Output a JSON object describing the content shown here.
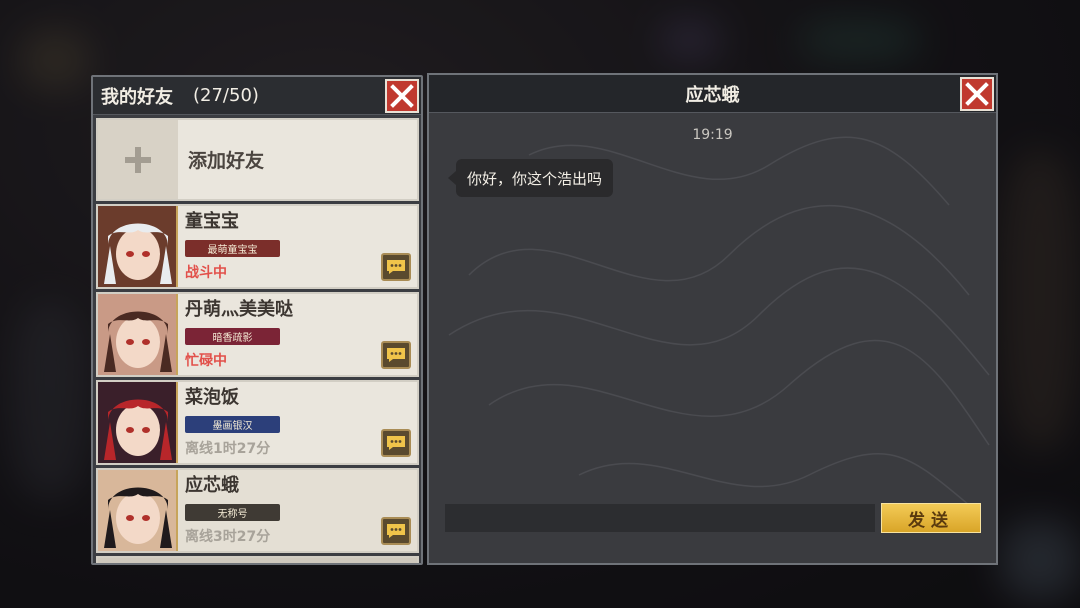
{
  "friends": {
    "title": "我的好友",
    "count": "(27/50)",
    "add_label": "添加好友",
    "list": [
      {
        "name": "童宝宝",
        "title": "最萌童宝宝",
        "status": "战斗中",
        "status_color": "#e2504a",
        "badge_color": "#7b2e2a",
        "avatar_hair": "#e9ecef",
        "avatar_bg": "#6b3c2c"
      },
      {
        "name": "丹萌灬美美哒",
        "title": "暗香疏影",
        "status": "忙碌中",
        "status_color": "#e2504a",
        "badge_color": "#7b2436",
        "avatar_hair": "#4a2a22",
        "avatar_bg": "#c99a86"
      },
      {
        "name": "菜泡饭",
        "title": "墨画银汉",
        "status": "离线1时27分",
        "status_color": "#a8a39a",
        "badge_color": "#2c3f7a",
        "avatar_hair": "#b8262a",
        "avatar_bg": "#3a1f2a"
      },
      {
        "name": "应芯蛾",
        "title": "无称号",
        "status": "离线3时27分",
        "status_color": "#a8a39a",
        "badge_color": "#3f3a34",
        "avatar_hair": "#1f1a1c",
        "avatar_bg": "#d8b79a"
      }
    ]
  },
  "chat": {
    "partner_name": "应芯蛾",
    "time": "19:19",
    "message": "你好，你这个浩出吗",
    "input_value": "",
    "send_label": "发送"
  },
  "colors": {
    "close_red": "#c0392f",
    "send_gold": "#e6b63c"
  }
}
